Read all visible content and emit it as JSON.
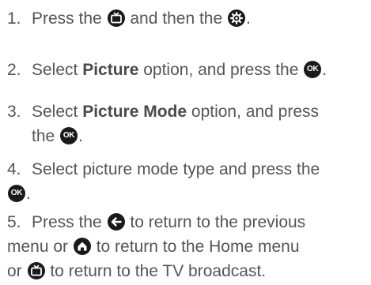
{
  "steps": [
    {
      "number": "1.",
      "lines": [
        {
          "t1": "Press the ",
          "icon1": "tv-icon",
          "t2": " and then the ",
          "icon2": "gear-icon",
          "t3": "."
        }
      ]
    },
    {
      "number": "2.",
      "lines": [
        {
          "t1": "Select ",
          "bold": "Picture",
          "t2": " option, and press the ",
          "icon1": "ok-icon",
          "t3": "."
        }
      ]
    },
    {
      "number": "3.",
      "lines": [
        {
          "t1": "Select ",
          "bold": "Picture Mode",
          "t2": " option, and press"
        },
        {
          "t1": "the ",
          "icon1": "ok-icon",
          "t2": "."
        }
      ]
    },
    {
      "number": "4.",
      "lines": [
        {
          "t1": "Select picture mode type and press the"
        },
        {
          "icon1": "ok-icon",
          "t1": "."
        }
      ]
    },
    {
      "number": "5.",
      "lines": [
        {
          "t1": "Press the ",
          "icon1": "back-arrow-icon",
          "t2": " to return to the previous"
        },
        {
          "t1": "menu or ",
          "icon1": "home-icon",
          "t2": " to return to the Home menu"
        },
        {
          "t1": "or ",
          "icon1": "tv-icon",
          "t2": " to return to the TV broadcast."
        }
      ]
    }
  ],
  "icons": {
    "ok_label": "OK"
  },
  "colors": {
    "text": "#555555",
    "icon_bg": "#1a1a1a",
    "icon_fg": "#ffffff"
  }
}
